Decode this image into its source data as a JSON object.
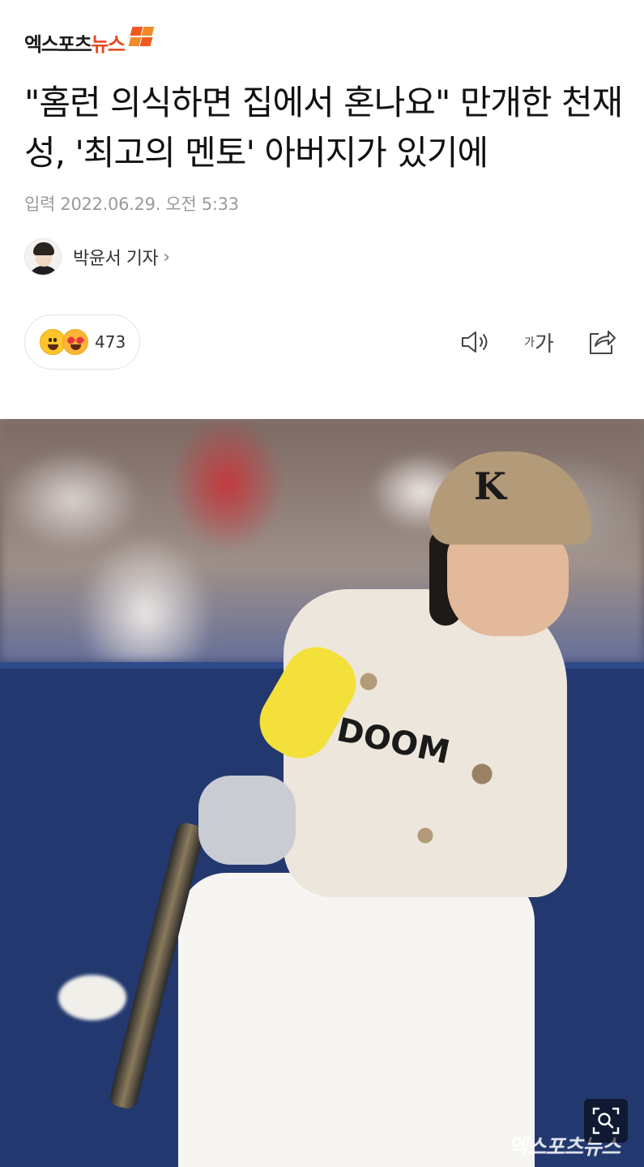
{
  "brand": {
    "logo_text": "엑스포츠뉴스",
    "logo_main": "엑스포츠",
    "logo_accent": "뉴스",
    "accent_color": "#e8461c"
  },
  "article": {
    "headline": "\"홈런 의식하면 집에서 혼나요\" 만개한 천재성, '최고의 멘토' 아버지가 있기에",
    "dateline": "입력 2022.06.29. 오전 5:33",
    "author": "박윤서 기자",
    "author_chevron": "›"
  },
  "reactions": {
    "count": "473",
    "emojis": [
      "grinning-face-icon",
      "heart-eyes-face-icon"
    ]
  },
  "toolbar": {
    "speaker_icon": "speaker-icon",
    "font_small": "가",
    "font_large": "가",
    "share_icon": "share-icon"
  },
  "photo": {
    "helmet_letter": "K",
    "watermark": "엑스포츠뉴스",
    "zoom_icon": "zoom-icon"
  }
}
